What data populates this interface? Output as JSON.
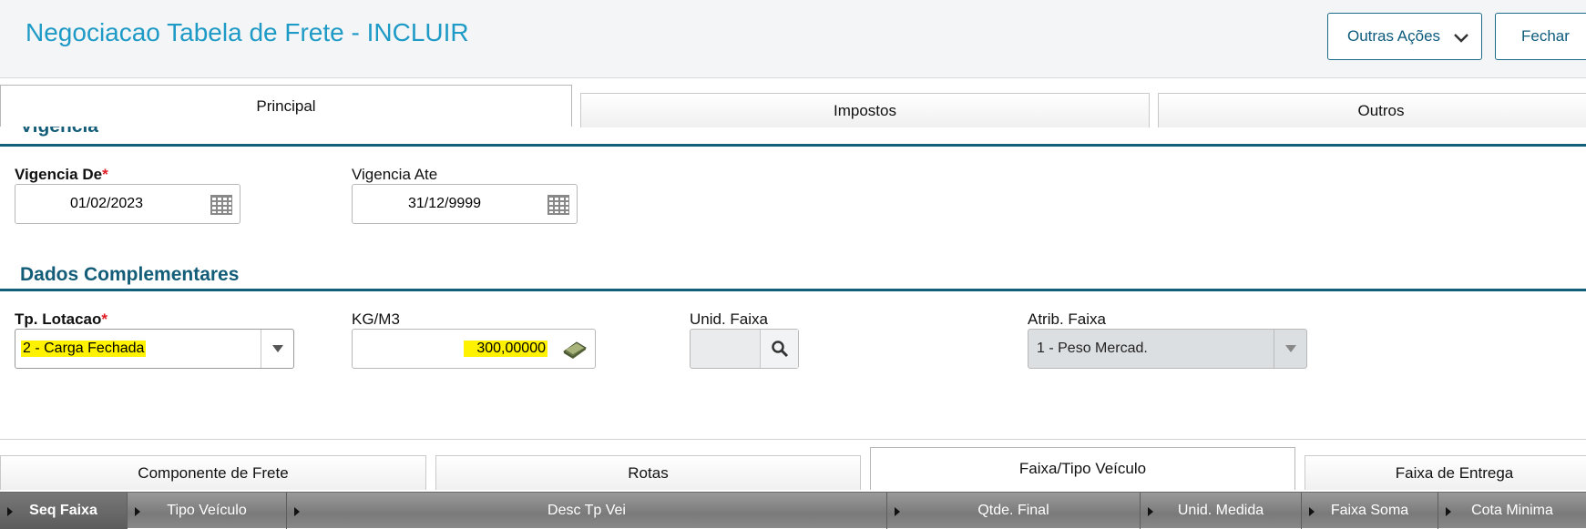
{
  "header": {
    "title": "Negociacao Tabela de Frete - INCLUIR",
    "outras_acoes": "Outras Ações",
    "fechar": "Fechar"
  },
  "tabs": [
    "Principal",
    "Impostos",
    "Outros"
  ],
  "vigencia": {
    "section_title": "Vigencia",
    "de_label": "Vigencia De",
    "de_value": "01/02/2023",
    "ate_label": "Vigencia Ate",
    "ate_value": "31/12/9999"
  },
  "dados": {
    "section_title": "Dados Complementares",
    "tp_lotacao_label": "Tp. Lotacao",
    "tp_lotacao_value": "2 - Carga Fechada",
    "kgm3_label": "KG/M3",
    "kgm3_value": "300,00000",
    "unid_faixa_label": "Unid. Faixa",
    "unid_faixa_value": "",
    "atrib_faixa_label": "Atrib. Faixa",
    "atrib_faixa_value": "1 - Peso Mercad."
  },
  "required_mark": "*",
  "sub_tabs": [
    "Componente de Frete",
    "Rotas",
    "Faixa/Tipo Veículo",
    "Faixa de Entrega"
  ],
  "grid_columns": [
    "Seq Faixa",
    "Tipo Veículo",
    "Desc Tp Vei",
    "Qtde. Final",
    "Unid. Medida",
    "Faixa Soma",
    "Cota Minima"
  ],
  "colors": {
    "title": "#1e9ac6",
    "section": "#135d78",
    "required": "#e01b24",
    "highlight": "#fff200"
  }
}
